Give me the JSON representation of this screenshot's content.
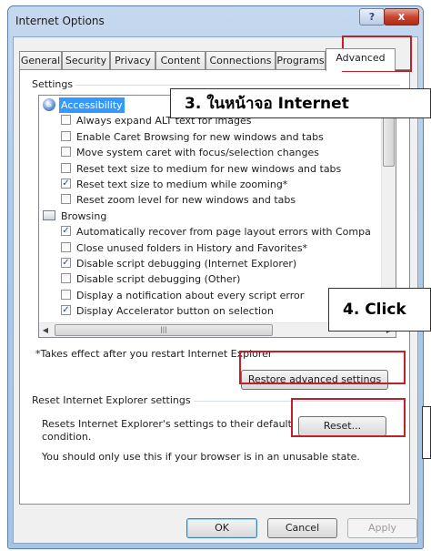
{
  "window": {
    "title": "Internet Options",
    "help_label": "?",
    "close_label": "x"
  },
  "tabs": [
    "General",
    "Security",
    "Privacy",
    "Content",
    "Connections",
    "Programs",
    "Advanced"
  ],
  "settings": {
    "group_label": "Settings",
    "items": [
      {
        "type": "category",
        "icon": "accessibility-icon",
        "label": "Accessibility",
        "selected": true
      },
      {
        "type": "checkbox",
        "checked": false,
        "label": "Always expand ALT text for images"
      },
      {
        "type": "checkbox",
        "checked": false,
        "label": "Enable Caret Browsing for new windows and tabs"
      },
      {
        "type": "checkbox",
        "checked": false,
        "label": "Move system caret with focus/selection changes"
      },
      {
        "type": "checkbox",
        "checked": false,
        "label": "Reset text size to medium for new windows and tabs"
      },
      {
        "type": "checkbox",
        "checked": true,
        "label": "Reset text size to medium while zooming*"
      },
      {
        "type": "checkbox",
        "checked": false,
        "label": "Reset zoom level for new windows and tabs"
      },
      {
        "type": "category",
        "icon": "browsing-icon",
        "label": "Browsing",
        "selected": false
      },
      {
        "type": "checkbox",
        "checked": true,
        "label": "Automatically recover from page layout errors with Compa"
      },
      {
        "type": "checkbox",
        "checked": false,
        "label": "Close unused folders in History and Favorites*"
      },
      {
        "type": "checkbox",
        "checked": true,
        "label": "Disable script debugging (Internet Explorer)"
      },
      {
        "type": "checkbox",
        "checked": false,
        "label": "Disable script debugging (Other)"
      },
      {
        "type": "checkbox",
        "checked": false,
        "label": "Display a notification about every script error"
      },
      {
        "type": "checkbox",
        "checked": true,
        "label": "Display Accelerator button on selection"
      }
    ],
    "footnote": "*Takes effect after you restart Internet Explorer",
    "restore_button": "Restore advanced settings"
  },
  "reset": {
    "group_label": "Reset Internet Explorer settings",
    "description_line1": "Resets Internet Explorer's settings to their default",
    "description_line2": "condition.",
    "button": "Reset...",
    "warning": "You should only use this if your browser is in an unusable state."
  },
  "footer": {
    "ok": "OK",
    "cancel": "Cancel",
    "apply": "Apply"
  },
  "callouts": {
    "step3": "3. ในหน้าจอ Internet",
    "step4": "4. Click"
  },
  "colors": {
    "highlight_red": "#c0202a",
    "selection_blue": "#3399ff"
  }
}
